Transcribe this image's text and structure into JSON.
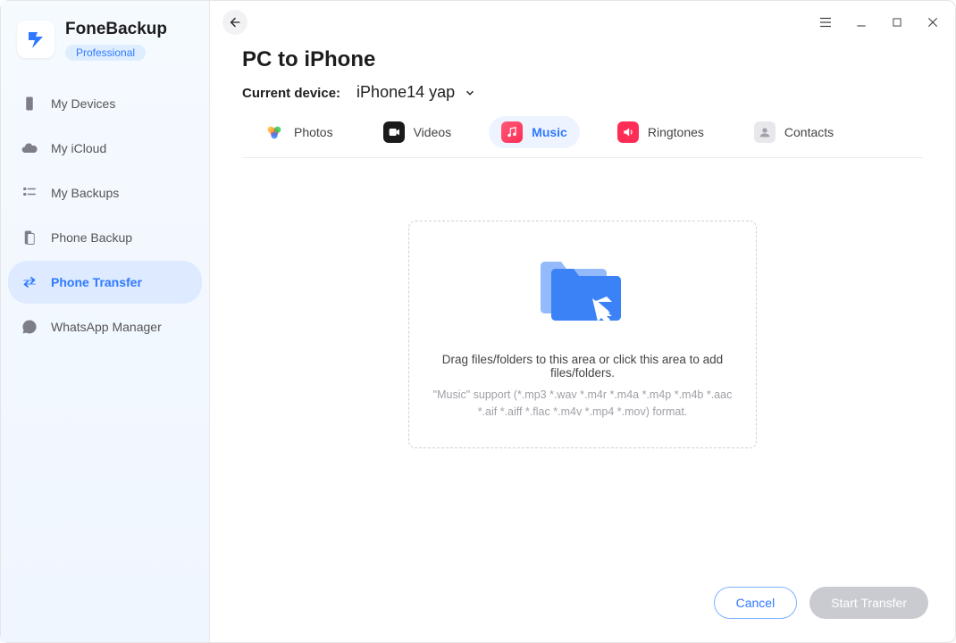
{
  "brand": {
    "title": "FoneBackup",
    "tier": "Professional"
  },
  "sidebar": {
    "items": [
      {
        "label": "My Devices"
      },
      {
        "label": "My iCloud"
      },
      {
        "label": "My Backups"
      },
      {
        "label": "Phone Backup"
      },
      {
        "label": "Phone Transfer"
      },
      {
        "label": "WhatsApp Manager"
      }
    ]
  },
  "page": {
    "title": "PC to iPhone",
    "currentDeviceLabel": "Current device:",
    "currentDeviceName": "iPhone14 yap"
  },
  "tabs": [
    {
      "label": "Photos"
    },
    {
      "label": "Videos"
    },
    {
      "label": "Music"
    },
    {
      "label": "Ringtones"
    },
    {
      "label": "Contacts"
    }
  ],
  "dropzone": {
    "prompt": "Drag files/folders to this area or click this area to add files/folders.",
    "supportText": "\"Music\" support (*.mp3 *.wav *.m4r *.m4a *.m4p *.m4b *.aac *.aif *.aiff *.flac *.m4v *.mp4 *.mov) format."
  },
  "footer": {
    "cancel": "Cancel",
    "start": "Start Transfer"
  }
}
